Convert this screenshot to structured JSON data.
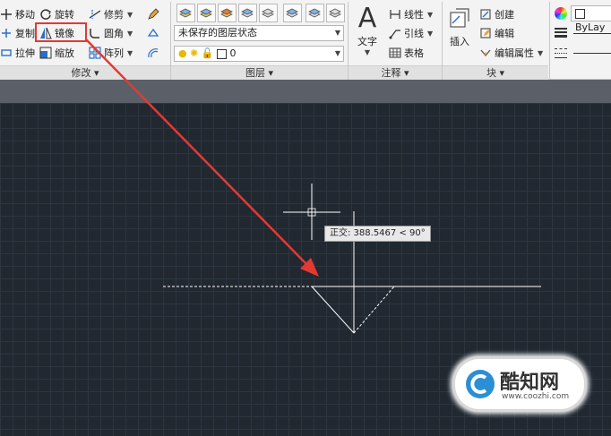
{
  "modify": {
    "title": "修改",
    "move": "移动",
    "rotate": "旋转",
    "trim": "修剪",
    "copy": "复制",
    "mirror": "镜像",
    "fillet": "圆角",
    "stretch": "拉伸",
    "scale": "缩放",
    "array": "阵列"
  },
  "layers": {
    "title": "图层",
    "layer_state": "未保存的图层状态",
    "current_layer": "0"
  },
  "annotation": {
    "title": "注释",
    "text": "文字",
    "linear": "线性",
    "leader": "引线",
    "table": "表格"
  },
  "block": {
    "title": "块",
    "insert": "插入",
    "create": "创建",
    "edit": "编辑",
    "edit_attributes": "编辑属性"
  },
  "properties": {
    "color_value": "ByLay"
  },
  "canvas": {
    "tooltip": "正交: 388.5467 < 90°"
  },
  "watermark": {
    "name": "酷知网",
    "url": "www.coozhi.com"
  },
  "colors": {
    "highlight": "#e23a33",
    "canvas": "#212830",
    "geometry": "#ffffff"
  }
}
